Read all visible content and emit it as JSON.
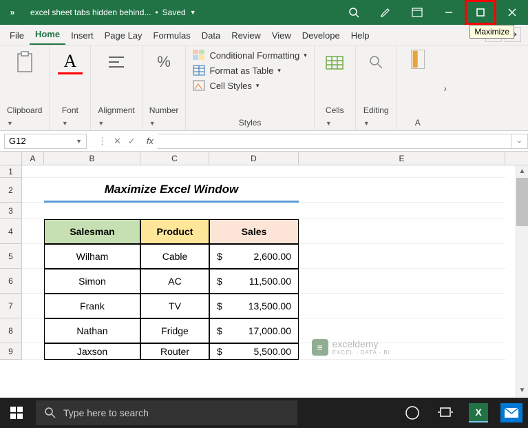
{
  "titlebar": {
    "autosave_glyph": "»",
    "filename": "excel sheet tabs hidden behind...",
    "save_status": "Saved",
    "tooltip": "Maximize"
  },
  "menu": {
    "items": [
      "File",
      "Home",
      "Insert",
      "Page Lay",
      "Formulas",
      "Data",
      "Review",
      "View",
      "Develope",
      "Help"
    ],
    "active_index": 1
  },
  "ribbon": {
    "clipboard": "Clipboard",
    "font": "Font",
    "alignment": "Alignment",
    "number": "Number",
    "styles_label": "Styles",
    "cond_fmt": "Conditional Formatting",
    "fmt_table": "Format as Table",
    "cell_styles": "Cell Styles",
    "cells": "Cells",
    "editing": "Editing",
    "addins_short": "A"
  },
  "namebox": {
    "value": "G12",
    "fx": "fx"
  },
  "columns": [
    "A",
    "B",
    "C",
    "D",
    "E"
  ],
  "row_headers": [
    "1",
    "2",
    "3",
    "4",
    "5",
    "6",
    "7",
    "8",
    "9"
  ],
  "sheet": {
    "title": "Maximize Excel Window",
    "headers": {
      "salesman": "Salesman",
      "product": "Product",
      "sales": "Sales"
    },
    "rows": [
      {
        "salesman": "Wilham",
        "product": "Cable",
        "currency": "$",
        "sales": "2,600.00"
      },
      {
        "salesman": "Simon",
        "product": "AC",
        "currency": "$",
        "sales": "11,500.00"
      },
      {
        "salesman": "Frank",
        "product": "TV",
        "currency": "$",
        "sales": "13,500.00"
      },
      {
        "salesman": "Nathan",
        "product": "Fridge",
        "currency": "$",
        "sales": "17,000.00"
      },
      {
        "salesman": "Jaxson",
        "product": "Router",
        "currency": "$",
        "sales": "5,500.00"
      }
    ]
  },
  "watermark": {
    "name": "exceldemy",
    "tag": "EXCEL · DATA · BI"
  },
  "taskbar": {
    "search_placeholder": "Type here to search"
  }
}
